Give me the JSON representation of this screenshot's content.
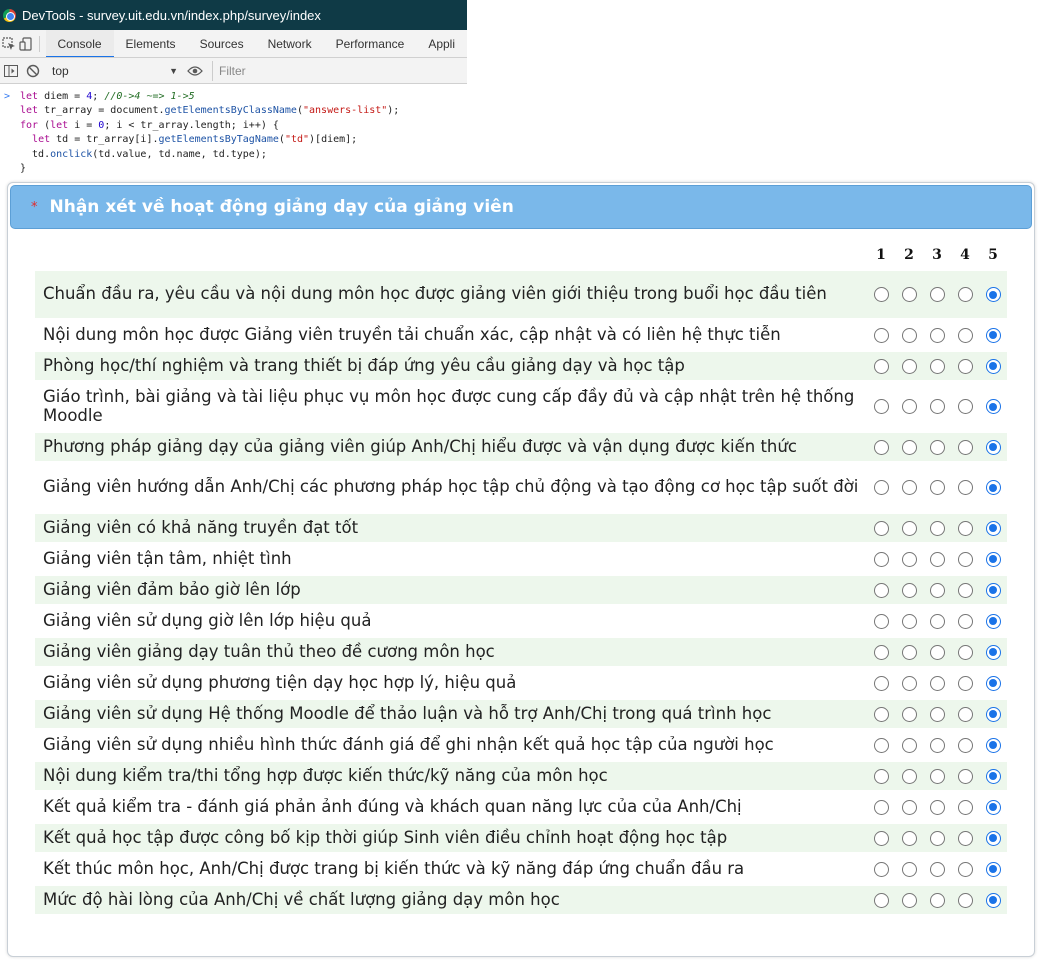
{
  "devtools": {
    "title": "DevTools - survey.uit.edu.vn/index.php/survey/index",
    "tabs": [
      "Console",
      "Elements",
      "Sources",
      "Network",
      "Performance",
      "Appli"
    ],
    "active_tab": "Console",
    "context": "top",
    "filter_placeholder": "Filter",
    "console_lines": [
      "let diem = 4; //0->4 ~=> 1->5",
      "let tr_array = document.getElementsByClassName(\"answers-list\");",
      "for (let i = 0; i < tr_array.length; i++) {",
      "  let td = tr_array[i].getElementsByTagName(\"td\")[diem];",
      "  td.onclick(td.value, td.name, td.type);",
      "}"
    ]
  },
  "survey": {
    "required_mark": "*",
    "title": "Nhận xét về hoạt động giảng dạy của giảng viên",
    "scale_labels": [
      "1",
      "2",
      "3",
      "4",
      "5"
    ],
    "selected_value": 5,
    "questions": [
      "Chuẩn đầu ra, yêu cầu và nội dung môn học được giảng viên giới thiệu trong buổi học đầu tiên",
      "Nội dung môn học được Giảng viên truyền tải chuẩn xác, cập nhật và có liên hệ thực tiễn",
      "Phòng học/thí nghiệm và trang thiết bị đáp ứng yêu cầu giảng dạy và học tập",
      "Giáo trình, bài giảng và tài liệu phục vụ môn học được cung cấp đầy đủ và cập nhật trên hệ thống Moodle",
      "Phương pháp giảng dạy của giảng viên giúp Anh/Chị hiểu được và vận dụng được kiến thức",
      "Giảng viên hướng dẫn Anh/Chị các phương pháp học tập chủ động và tạo động cơ học tập suốt đời",
      "Giảng viên có khả năng truyền đạt tốt",
      "Giảng viên tận tâm, nhiệt tình",
      "Giảng viên đảm bảo giờ lên lớp",
      "Giảng viên sử dụng giờ lên lớp hiệu quả",
      "Giảng viên giảng dạy tuân thủ theo đề cương môn học",
      "Giảng viên sử dụng phương tiện dạy học hợp lý, hiệu quả",
      "Giảng viên sử dụng Hệ thống Moodle để thảo luận và hỗ trợ Anh/Chị trong quá trình học",
      "Giảng viên sử dụng nhiều hình thức đánh giá để ghi nhận kết quả học tập của người học",
      "Nội dung kiểm tra/thi tổng hợp được kiến thức/kỹ năng của môn học",
      "Kết quả kiểm tra - đánh giá phản ảnh đúng và khách quan năng lực của của Anh/Chị",
      "Kết quả học tập được công bố kịp thời giúp Sinh viên điều chỉnh hoạt động học tập",
      "Kết thúc môn học, Anh/Chị được trang bị kiến thức và kỹ năng đáp ứng chuẩn đầu ra",
      "Mức độ hài lòng của Anh/Chị về chất lượng giảng dạy môn học"
    ]
  },
  "colors": {
    "header_bg": "#7ab8ea",
    "row_alt_bg": "#edf7ec",
    "radio_checked": "#1a73e8",
    "devtools_titlebar": "#0f3a46"
  }
}
